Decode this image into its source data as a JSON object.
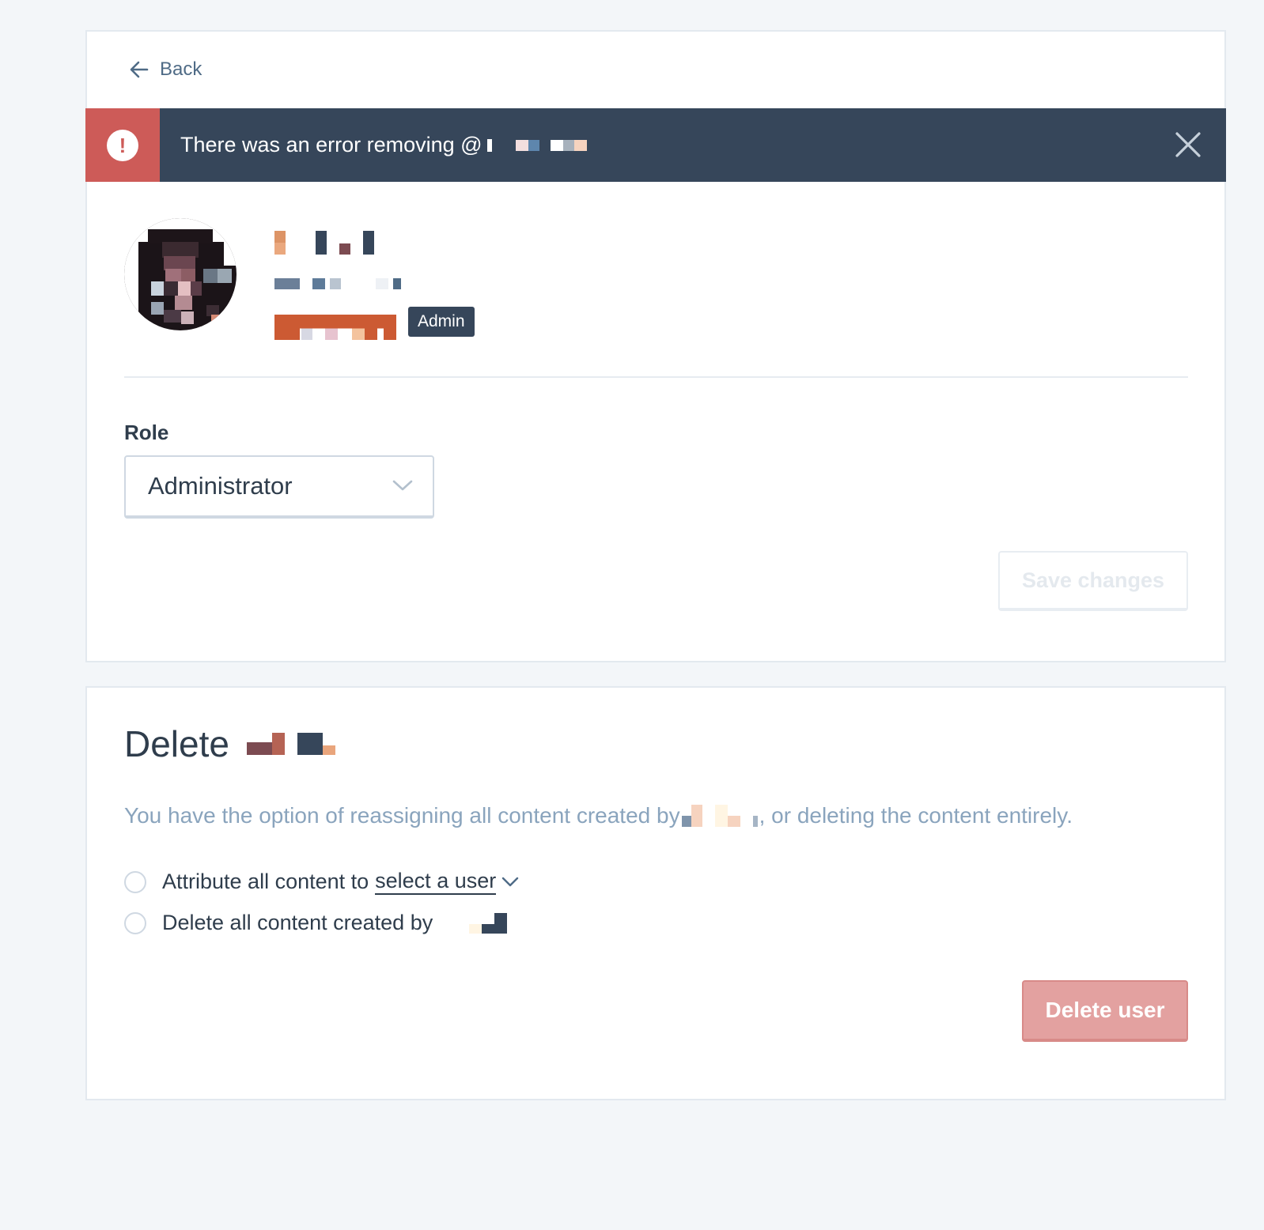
{
  "nav": {
    "back_label": "Back"
  },
  "banner": {
    "message": "There was an error removing @",
    "icon": "alert-icon",
    "close_icon": "close-icon",
    "accent_color": "#cd5b58",
    "background_color": "#36465a"
  },
  "profile": {
    "badge": "Admin"
  },
  "role": {
    "label": "Role",
    "selected": "Administrator"
  },
  "actions": {
    "save_label": "Save changes",
    "delete_label": "Delete user"
  },
  "delete_section": {
    "title": "Delete",
    "description_prefix": "You have the option of reassigning all content created by",
    "description_suffix": ", or deleting the content entirely.",
    "option_attribute_prefix": "Attribute all content to",
    "option_attribute_select": "select a user",
    "option_delete": "Delete all content created by"
  }
}
